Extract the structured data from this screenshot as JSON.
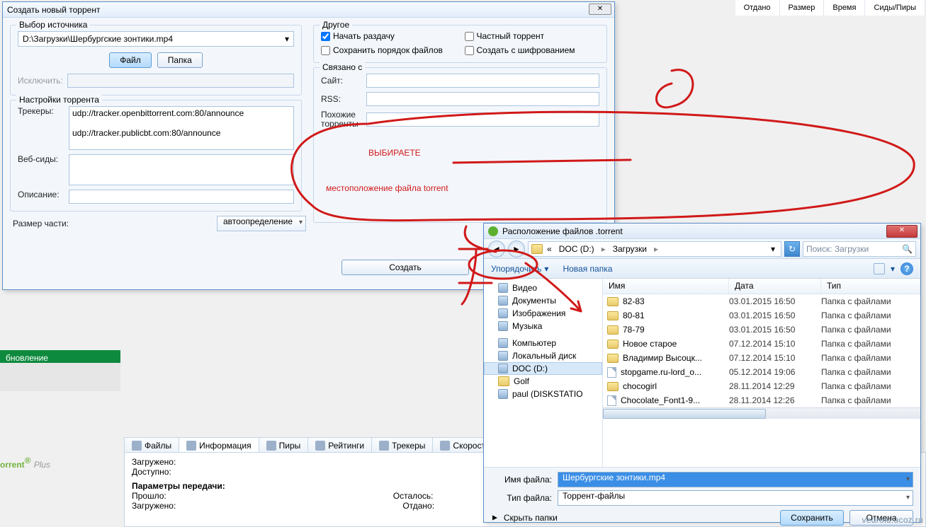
{
  "bg": {
    "cols": [
      "Отдано",
      "Размер",
      "Время",
      "Сиды/Пиры"
    ],
    "green": "бновление",
    "brand_a": "orrent",
    "brand_b": "Plus",
    "tabs": [
      "Файлы",
      "Информация",
      "Пиры",
      "Рейтинги",
      "Трекеры",
      "Скорость"
    ],
    "info": {
      "loaded": "Загружено:",
      "avail": "Доступно:",
      "params": "Параметры передачи:",
      "elapsed": "Прошло:",
      "dl": "Загружено:",
      "remain": "Осталось:",
      "given": "Отдано:"
    }
  },
  "create": {
    "title": "Создать новый торрент",
    "src_legend": "Выбор источника",
    "path": "D:\\Загрузки\\Шербургские зонтики.mp4",
    "file_btn": "Файл",
    "folder_btn": "Папка",
    "exclude": "Исключить:",
    "ts_legend": "Настройки торрента",
    "trackers_lbl": "Трекеры:",
    "trackers": "udp://tracker.openbittorrent.com:80/announce\n\nudp://tracker.publicbt.com:80/announce",
    "webseeds_lbl": "Веб-сиды:",
    "desc_lbl": "Описание:",
    "piece_lbl": "Размер части:",
    "piece_val": "автоопределение",
    "other_legend": "Другое",
    "chk1": "Начать раздачу",
    "chk2": "Сохранить порядок файлов",
    "chk3": "Частный торрент",
    "chk4": "Создать с шифрованием",
    "rel_legend": "Связано с",
    "site": "Сайт:",
    "rss": "RSS:",
    "similar": "Похожие торренты",
    "create_btn": "Создать"
  },
  "save": {
    "title": "Расположение файлов .torrent",
    "crumb_prefix": "«",
    "crumb1": "DOC (D:)",
    "crumb2": "Загрузки",
    "search_ph": "Поиск: Загрузки",
    "organize": "Упорядочить",
    "newfolder": "Новая папка",
    "tree": [
      {
        "icon": "g",
        "label": "Видео"
      },
      {
        "icon": "g",
        "label": "Документы"
      },
      {
        "icon": "g",
        "label": "Изображения"
      },
      {
        "icon": "g",
        "label": "Музыка"
      },
      {
        "gap": true
      },
      {
        "icon": "g",
        "label": "Компьютер"
      },
      {
        "icon": "g",
        "label": "Локальный диск"
      },
      {
        "icon": "g",
        "label": "DOC (D:)",
        "sel": true
      },
      {
        "icon": "f",
        "label": "Golf"
      },
      {
        "icon": "g",
        "label": "paul (DISKSTATIO"
      }
    ],
    "cols": [
      "Имя",
      "Дата",
      "Тип"
    ],
    "rows": [
      {
        "t": "folder",
        "n": "82-83",
        "d": "03.01.2015 16:50",
        "k": "Папка с файлами"
      },
      {
        "t": "folder",
        "n": "80-81",
        "d": "03.01.2015 16:50",
        "k": "Папка с файлами"
      },
      {
        "t": "folder",
        "n": "78-79",
        "d": "03.01.2015 16:50",
        "k": "Папка с файлами"
      },
      {
        "t": "folder",
        "n": "Новое старое",
        "d": "07.12.2014 15:10",
        "k": "Папка с файлами"
      },
      {
        "t": "folder",
        "n": "Владимир Высоцк...",
        "d": "07.12.2014 15:10",
        "k": "Папка с файлами"
      },
      {
        "t": "file",
        "n": "stopgame.ru-lord_o...",
        "d": "05.12.2014 19:06",
        "k": "Папка с файлами"
      },
      {
        "t": "folder",
        "n": "chocogirl",
        "d": "28.11.2014 12:29",
        "k": "Папка с файлами"
      },
      {
        "t": "file",
        "n": "Chocolate_Font1-9...",
        "d": "28.11.2014 12:26",
        "k": "Папка с файлами"
      }
    ],
    "fname_lbl": "Имя файла:",
    "fname_val": "Шербургские зонтики.mp4",
    "ftype_lbl": "Тип файла:",
    "ftype_val": "Торрент-файлы",
    "hide": "Скрыть папки",
    "save_btn": "Сохранить",
    "cancel_btn": "Отмена"
  },
  "annotation": {
    "text_top": "ВЫБИРАЕТЕ",
    "text_bottom": "местоположение файла torrent",
    "six": "6",
    "seven": "7"
  },
  "watermark": "vedroid.ucoz.ru"
}
